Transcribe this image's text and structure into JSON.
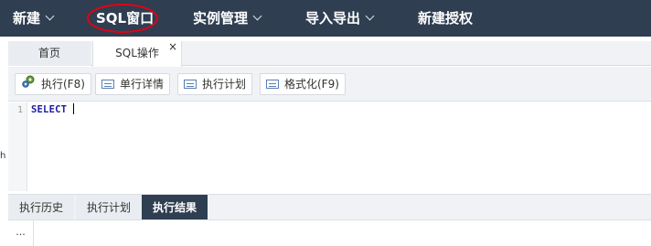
{
  "topnav": {
    "items": [
      {
        "label": "新建",
        "has_dropdown": true
      },
      {
        "label": "SQL窗口",
        "has_dropdown": false,
        "highlighted": true
      },
      {
        "label": "实例管理",
        "has_dropdown": true
      },
      {
        "label": "导入导出",
        "has_dropdown": true
      },
      {
        "label": "新建授权",
        "has_dropdown": false
      }
    ],
    "background": "#2f3e51",
    "highlight_color": "#e60012"
  },
  "tabs": {
    "home": "首页",
    "sql": "SQL操作",
    "close_symbol": "×"
  },
  "toolbar": {
    "execute": "执行(F8)",
    "step_detail": "单行详情",
    "execution_plan": "执行计划",
    "format": "格式化(F9)"
  },
  "editor": {
    "line_number": "1",
    "content": "SELECT"
  },
  "stray_mark": "h",
  "bottom_tabs": {
    "history": "执行历史",
    "plan": "执行计划",
    "result": "执行结果",
    "active": "执行结果"
  },
  "results": {
    "ellipsis": "..."
  }
}
